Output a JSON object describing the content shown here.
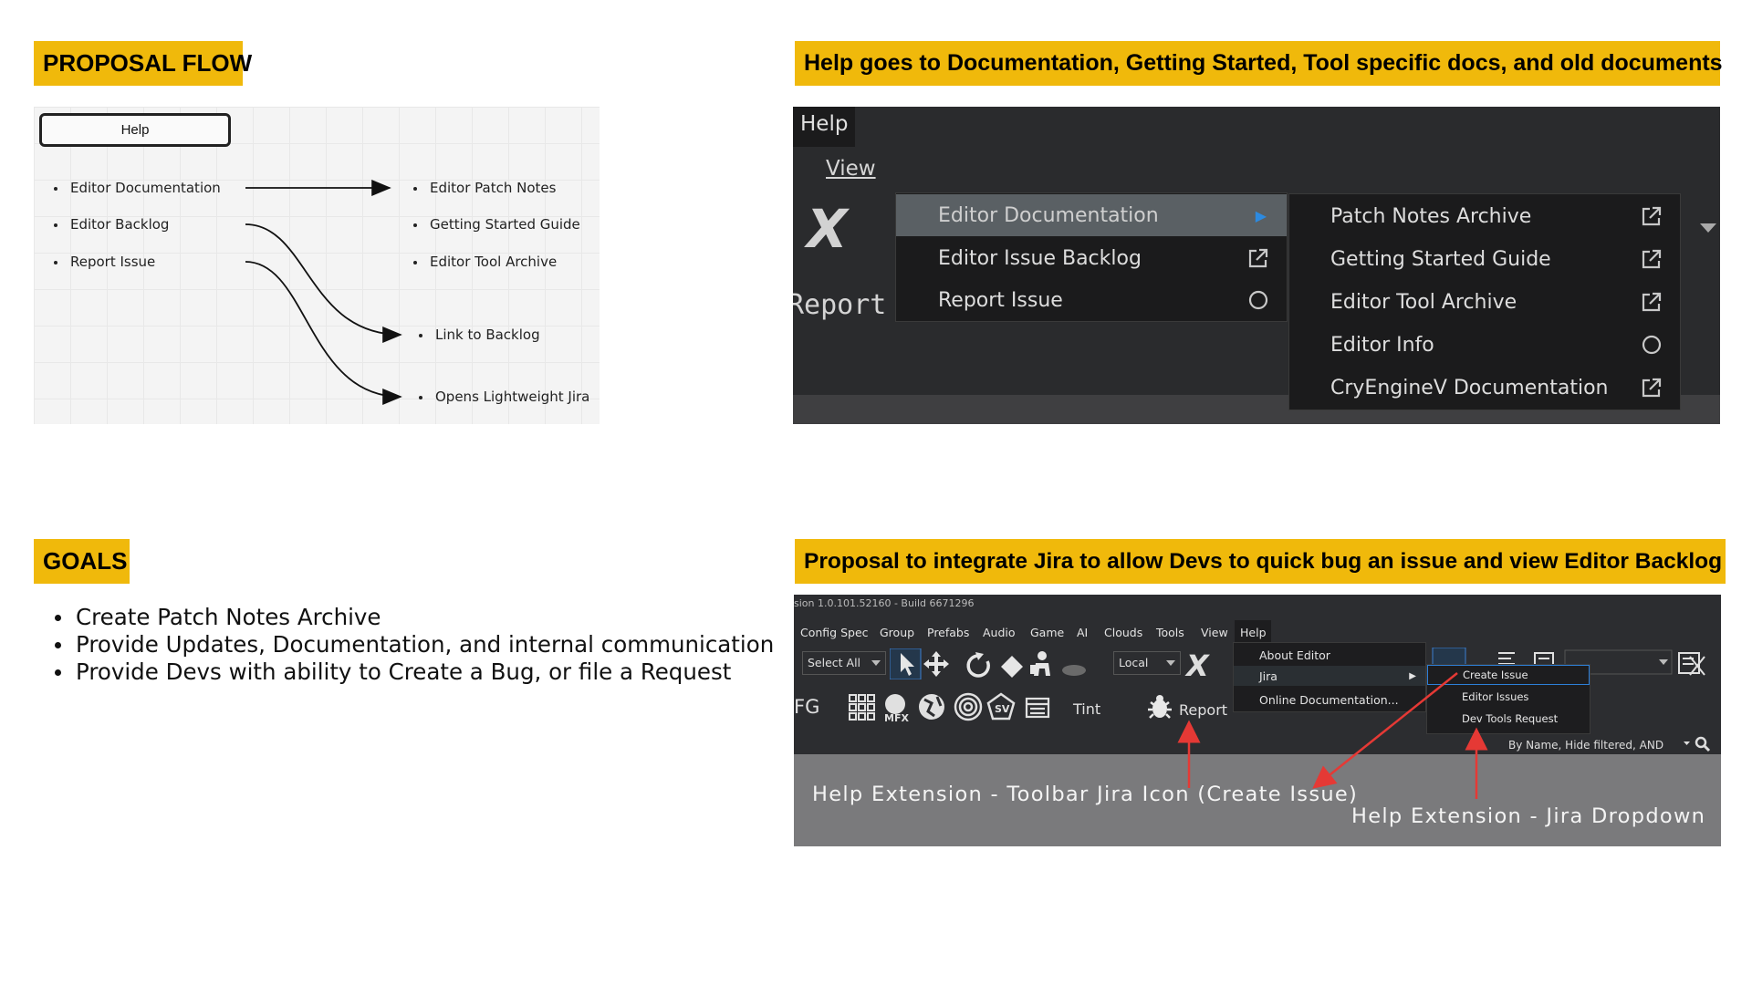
{
  "banners": {
    "proposal_flow": "PROPOSAL FLOW",
    "help_goes": "Help goes to Documentation, Getting Started, Tool specific docs, and old documents",
    "goals": "GOALS",
    "jira_proposal": "Proposal to integrate Jira to allow Devs to quick bug an issue and view Editor Backlog"
  },
  "flow": {
    "help_box": "Help",
    "left_items": [
      "Editor Documentation",
      "Editor Backlog",
      "Report Issue"
    ],
    "right_items": [
      "Editor Patch Notes",
      "Getting Started Guide",
      "Editor Tool Archive"
    ],
    "link_backlog": "Link to Backlog",
    "open_jira": "Opens Lightweight Jira"
  },
  "help_shot": {
    "menu_view": "View",
    "menu_help": "Help",
    "big_x": "X",
    "report": "Report",
    "main_menu": [
      {
        "label": "Editor Documentation",
        "icon": "submenu-arrow-icon"
      },
      {
        "label": "Editor Issue Backlog",
        "icon": "external-link-icon"
      },
      {
        "label": "Report Issue",
        "icon": "circle-icon"
      }
    ],
    "submenu": [
      {
        "label": "Patch Notes Archive",
        "icon": "external-link-icon"
      },
      {
        "label": "Getting Started Guide",
        "icon": "external-link-icon"
      },
      {
        "label": "Editor Tool Archive",
        "icon": "external-link-icon"
      },
      {
        "label": "Editor Info",
        "icon": "circle-icon"
      },
      {
        "label": "CryEngineV Documentation",
        "icon": "external-link-icon"
      }
    ]
  },
  "goals": [
    "Create Patch Notes Archive",
    "Provide Updates, Documentation, and internal communication",
    "Provide Devs with ability to Create a Bug, or file a Request"
  ],
  "jira_shot": {
    "version": "sion 1.0.101.52160 - Build 6671296",
    "menubar": [
      "Config Spec",
      "Group",
      "Prefabs",
      "Audio",
      "Game",
      "AI",
      "Clouds",
      "Tools",
      "View",
      "Help"
    ],
    "select_all": "Select All",
    "local": "Local",
    "fg": "FG",
    "tint": "Tint",
    "report": "Report",
    "big_x": "X",
    "help_menu": [
      "About Editor",
      "Jira",
      "Online Documentation..."
    ],
    "jira_submenu": [
      "Create Issue",
      "Editor Issues",
      "Dev Tools Request"
    ],
    "filter": "By Name, Hide filtered, AND",
    "note_toolbar": "Help Extension - Toolbar Jira Icon (Create Issue)",
    "note_dropdown": "Help Extension - Jira Dropdown",
    "arrow_color": "#e53935"
  }
}
